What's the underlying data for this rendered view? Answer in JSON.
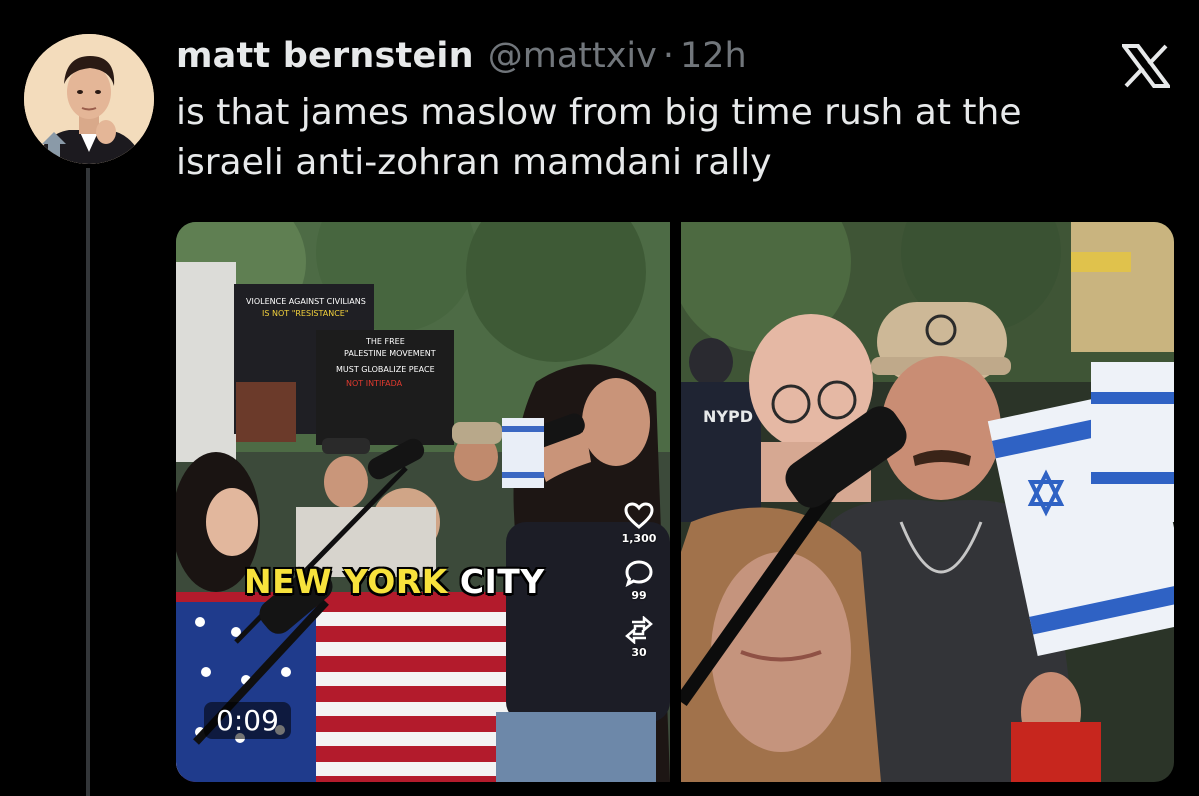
{
  "author": {
    "display_name": "matt bernstein",
    "handle": "@mattxiv",
    "separator": "·",
    "time": "12h"
  },
  "tweet": {
    "text": "is that james maslow from big time rush at the\nisraeli anti-zohran mamdani rally"
  },
  "media": {
    "left_video": {
      "caption_part1": "NEW YORK",
      "caption_part2": "CITY",
      "duration": "0:09",
      "likes": "1,300",
      "comments": "99",
      "reposts": "30"
    },
    "signs": {
      "sign1_line1": "VIOLENCE AGAINST CIVILIANS",
      "sign1_line2": "IS NOT \"RESISTANCE\"",
      "sign2_line1": "THE FREE",
      "sign2_line2": "PALESTINE MOVEMENT",
      "sign2_line3": "MUST GLOBALIZE PEACE",
      "sign2_line4": "NOT INTIFADA"
    },
    "right_photo": {
      "badge": "NYPD"
    }
  },
  "colors": {
    "background": "#000000",
    "text_primary": "#e7e9ea",
    "text_secondary": "#71767b",
    "thread_line": "#333639",
    "caption_yellow": "#f7e23c"
  },
  "icons": {
    "brand": "x-logo-icon",
    "like": "heart-icon",
    "comment": "comment-icon",
    "repost": "repost-icon"
  }
}
